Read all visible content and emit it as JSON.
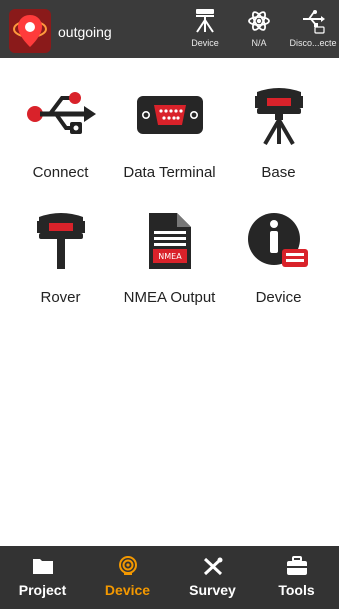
{
  "header": {
    "title": "outgoing",
    "logo_icon": "app-pin-logo",
    "status": [
      {
        "label": "Device",
        "icon": "receiver-tripod-icon"
      },
      {
        "label": "N/A",
        "icon": "satellite-atom-icon"
      },
      {
        "label": "Disco...ecte",
        "icon": "usb-disconnected-icon"
      }
    ]
  },
  "grid": {
    "items": [
      {
        "label": "Connect",
        "icon": "usb-icon"
      },
      {
        "label": "Data Terminal",
        "icon": "serial-port-icon"
      },
      {
        "label": "Base",
        "icon": "base-station-icon"
      },
      {
        "label": "Rover",
        "icon": "rover-icon"
      },
      {
        "label": "NMEA Output",
        "icon": "nmea-document-icon"
      },
      {
        "label": "Device",
        "icon": "device-info-icon"
      }
    ]
  },
  "bottomnav": {
    "items": [
      {
        "label": "Project",
        "icon": "folder-icon",
        "active": false
      },
      {
        "label": "Device",
        "icon": "signal-pin-icon",
        "active": true
      },
      {
        "label": "Survey",
        "icon": "survey-tools-icon",
        "active": false
      },
      {
        "label": "Tools",
        "icon": "toolbox-icon",
        "active": false
      }
    ]
  },
  "colors": {
    "header_bg": "#3b3b3b",
    "nav_bg": "#333333",
    "accent": "#f39800",
    "brand_red": "#d9222a"
  }
}
